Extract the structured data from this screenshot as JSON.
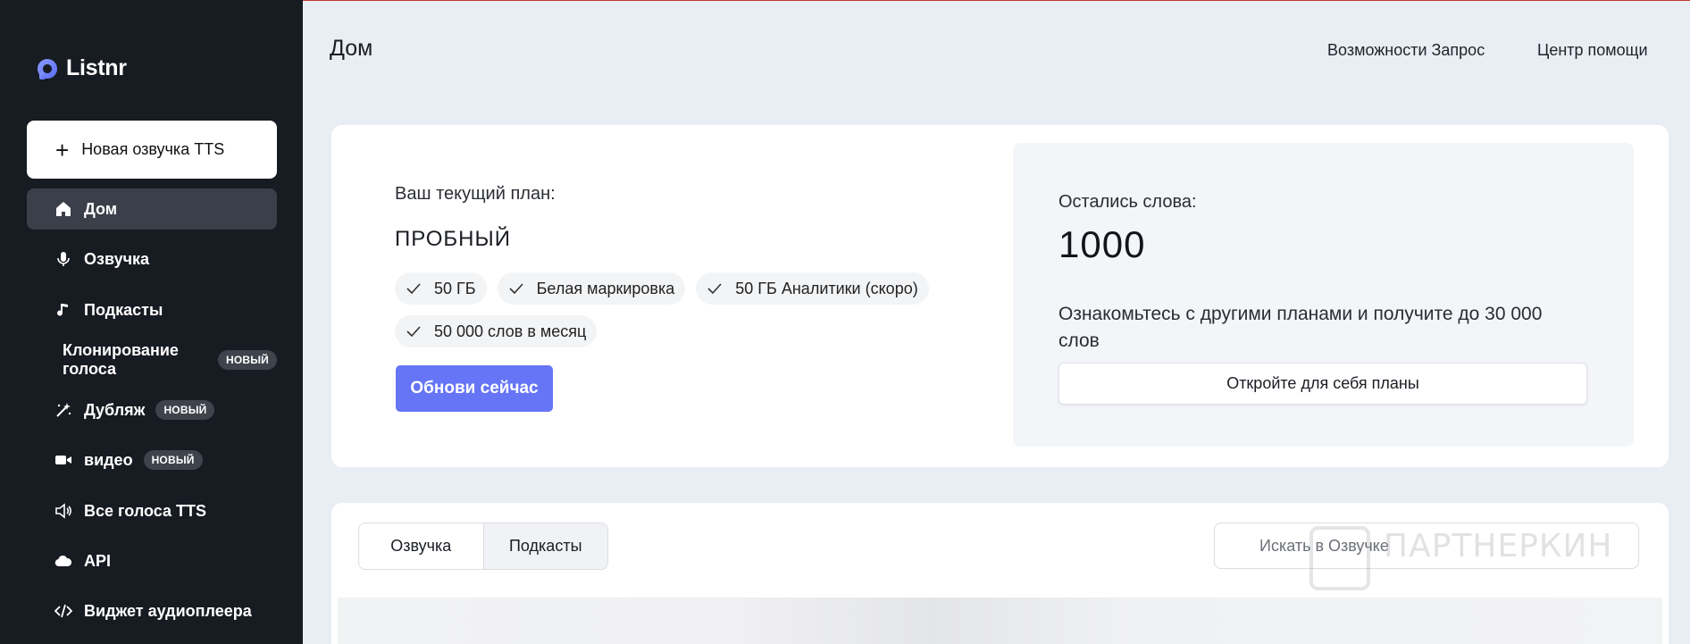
{
  "app": {
    "logo_text": "Listnr",
    "accent_color": "#6675f6",
    "sidebar_bg": "#171b22"
  },
  "sidebar": {
    "new_button_label": "Новая озвучка TTS",
    "items": [
      {
        "label": "Дом",
        "icon": "home-icon",
        "active": true
      },
      {
        "label": "Озвучка",
        "icon": "microphone-icon"
      },
      {
        "label": "Подкасты",
        "icon": "music-note-icon"
      },
      {
        "label": "Клонирование голоса",
        "badge": "НОВЫЙ"
      },
      {
        "label": "Дубляж",
        "icon": "magic-wand-icon",
        "badge": "НОВЫЙ"
      },
      {
        "label": "видео",
        "icon": "video-camera-icon",
        "badge": "НОВЫЙ"
      },
      {
        "label": "Все голоса TTS",
        "icon": "speaker-icon"
      },
      {
        "label": "API",
        "icon": "cloud-icon"
      },
      {
        "label": "Виджет аудиоплеера",
        "icon": "code-icon"
      }
    ]
  },
  "header": {
    "title": "Дом",
    "links": [
      "Возможности Запрос",
      "Центр помощи"
    ]
  },
  "plan": {
    "label": "Ваш текущий план:",
    "name": "ПРОБНЫЙ",
    "features": [
      "50 ГБ",
      "Белая маркировка",
      "50 ГБ Аналитики (скоро)",
      "50 000 слов в месяц"
    ],
    "upgrade_label": "Обнови сейчас"
  },
  "words": {
    "label": "Остались слова:",
    "count": "1000",
    "description": "Ознакомьтесь с другими планами и получите до 30 000 слов",
    "plans_button": "Откройте для себя планы"
  },
  "library": {
    "tabs": [
      "Озвучка",
      "Подкасты"
    ],
    "search_placeholder": "Искать в Озвучке"
  },
  "watermark": {
    "text": "ПАРТНЕРКИН"
  }
}
